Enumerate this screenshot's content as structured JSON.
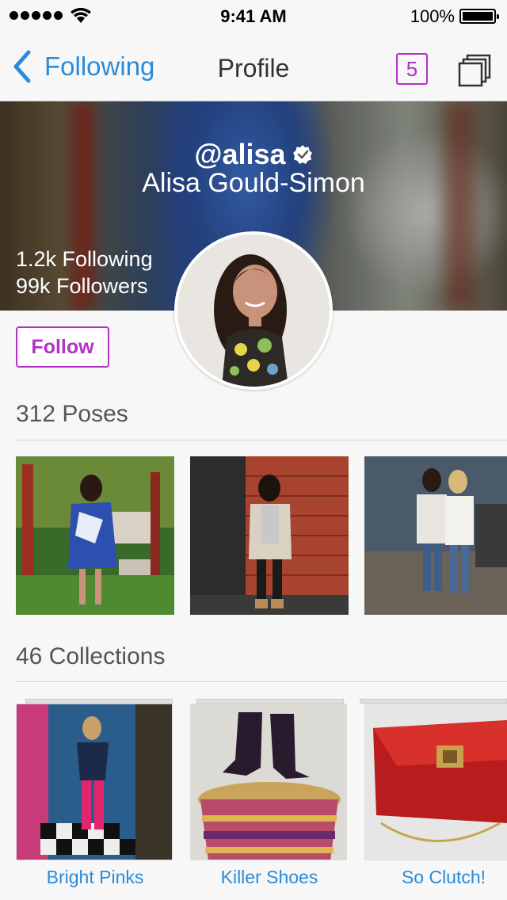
{
  "status_bar": {
    "time": "9:41 AM",
    "battery": "100%"
  },
  "nav": {
    "back_label": "Following",
    "title": "Profile",
    "badge_count": "5"
  },
  "profile": {
    "handle": "@alisa",
    "name": "Alisa Gould-Simon",
    "following": "1.2k Following",
    "followers": "99k Followers",
    "follow_label": "Follow"
  },
  "poses": {
    "title": "312 Poses"
  },
  "collections": {
    "title": "46 Collections",
    "items": [
      {
        "label": "Bright Pinks"
      },
      {
        "label": "Killer Shoes"
      },
      {
        "label": "So Clutch!"
      }
    ]
  },
  "colors": {
    "accent_purple": "#b431c7",
    "link_blue": "#2b8bd8",
    "background": "#f7f7f7"
  }
}
